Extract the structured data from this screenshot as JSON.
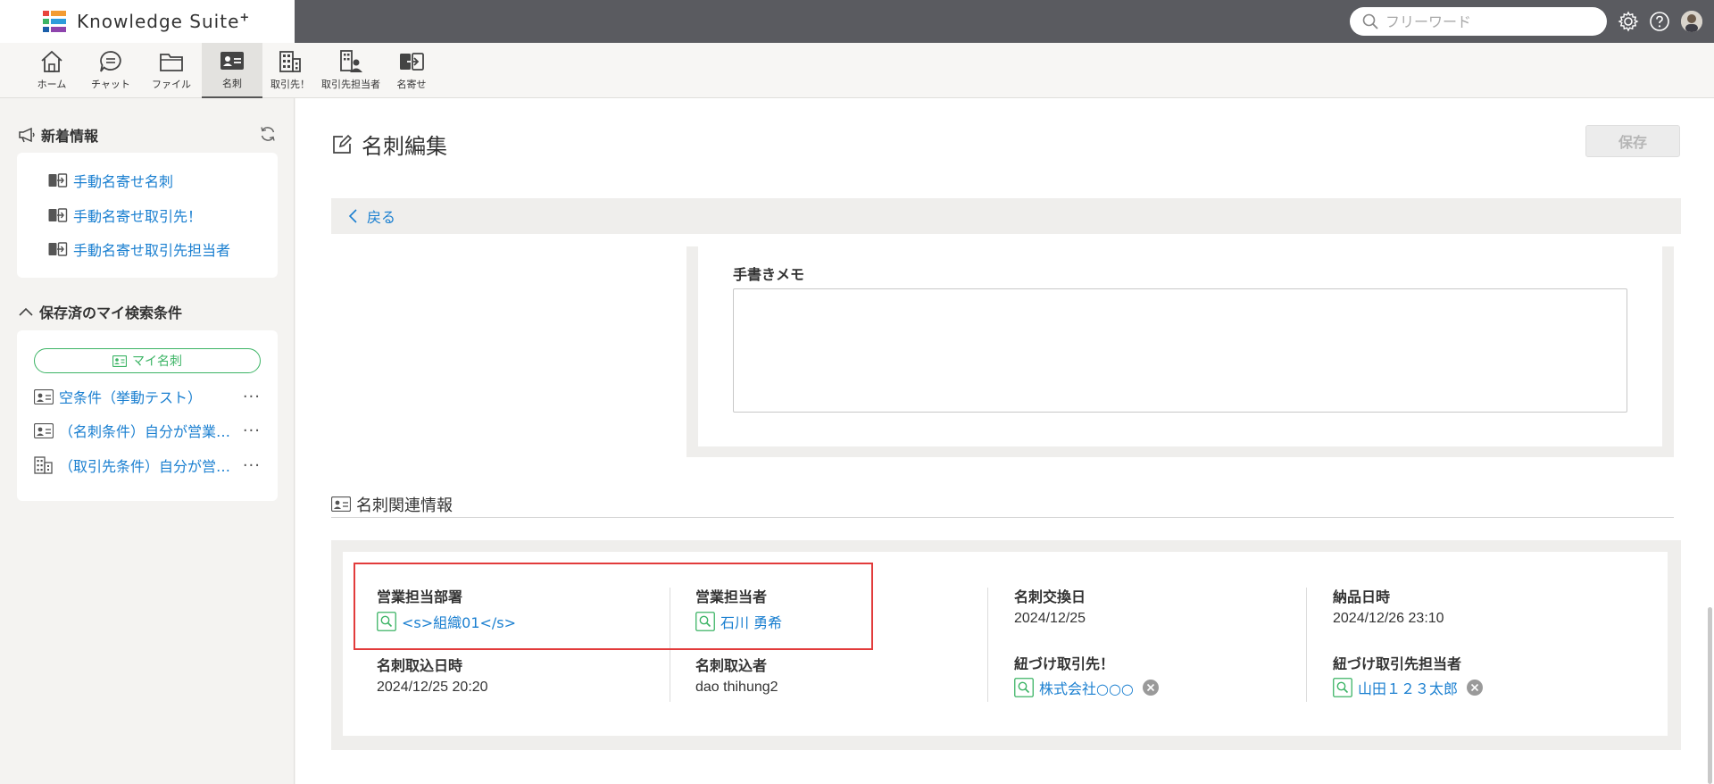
{
  "app": {
    "name": "Knowledge Suite",
    "name_suffix": "+"
  },
  "search": {
    "placeholder": "フリーワード"
  },
  "nav": {
    "items": [
      {
        "label": "ホーム",
        "icon": "home-icon"
      },
      {
        "label": "チャット",
        "icon": "chat-icon"
      },
      {
        "label": "ファイル",
        "icon": "folder-icon"
      },
      {
        "label": "名刺",
        "icon": "business-card-icon",
        "active": true
      },
      {
        "label": "取引先！",
        "icon": "building-icon"
      },
      {
        "label": "取引先担当者",
        "icon": "contact-person-icon"
      },
      {
        "label": "名寄せ",
        "icon": "merge-icon"
      }
    ]
  },
  "sidebar": {
    "news": {
      "title": "新着情報",
      "links": [
        "手動名寄せ名刺",
        "手動名寄せ取引先！",
        "手動名寄せ取引先担当者"
      ]
    },
    "saved": {
      "title": "保存済のマイ検索条件",
      "my_card_button": "マイ名刺",
      "conditions": [
        {
          "text": "空条件（挙動テスト）",
          "icon": "business-card-icon"
        },
        {
          "text": "（名刺条件）自分が営業担当者",
          "icon": "business-card-icon"
        },
        {
          "text": "（取引先条件）自分が営業担当者",
          "icon": "building-icon"
        }
      ],
      "more_label": "···"
    }
  },
  "main": {
    "title": "名刺編集",
    "save_label": "保存",
    "back_label": "戻る",
    "memo_label": "手書きメモ",
    "section_title": "名刺関連情報",
    "fields": {
      "sales_dept": {
        "label": "営業担当部署",
        "value": "<s>組織01</s>"
      },
      "sales_person": {
        "label": "営業担当者",
        "value": "石川 勇希"
      },
      "exchange_date": {
        "label": "名刺交換日",
        "value": "2024/12/25"
      },
      "delivery_datetime": {
        "label": "納品日時",
        "value": "2024/12/26 23:10"
      },
      "import_datetime": {
        "label": "名刺取込日時",
        "value": "2024/12/25 20:20"
      },
      "importer": {
        "label": "名刺取込者",
        "value": "dao thihung2"
      },
      "linked_company": {
        "label": "紐づけ取引先！",
        "value": "株式会社○○○"
      },
      "linked_contact": {
        "label": "紐づけ取引先担当者",
        "value": "山田１２３太郎"
      }
    }
  },
  "colors": {
    "link": "#1a7fd0",
    "accent_green": "#3cb465",
    "highlight_red": "#e23b3b",
    "topbar": "#5a5b60"
  }
}
